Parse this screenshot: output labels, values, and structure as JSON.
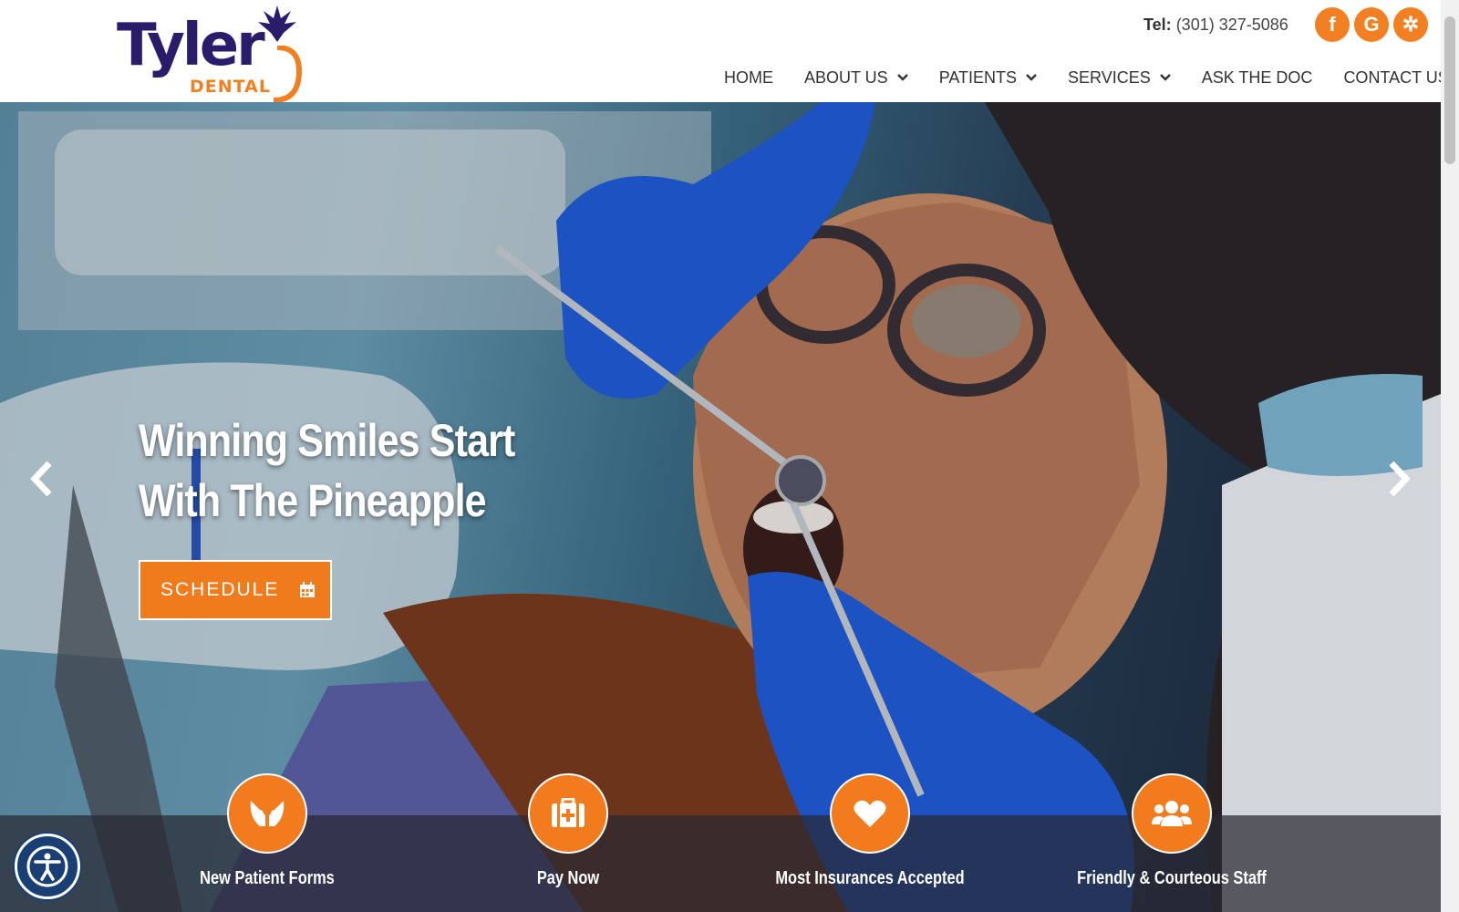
{
  "header": {
    "logo": {
      "name": "Tyler",
      "sub": "DENTAL"
    },
    "tel_label": "Tel:",
    "tel_number": "(301) 327-5086",
    "social": [
      {
        "icon": "facebook-icon",
        "glyph": "f"
      },
      {
        "icon": "google-icon",
        "glyph": "G"
      },
      {
        "icon": "yelp-icon",
        "glyph": "✲"
      }
    ],
    "nav": [
      {
        "label": "HOME",
        "dropdown": false
      },
      {
        "label": "ABOUT US",
        "dropdown": true
      },
      {
        "label": "PATIENTS",
        "dropdown": true
      },
      {
        "label": "SERVICES",
        "dropdown": true
      },
      {
        "label": "ASK THE DOC",
        "dropdown": false
      },
      {
        "label": "CONTACT US",
        "dropdown": false
      }
    ]
  },
  "hero": {
    "headline_line1": "Winning Smiles Start",
    "headline_line2": "With The Pineapple",
    "cta_label": "SCHEDULE"
  },
  "features": [
    {
      "label": "New Patient Forms",
      "icon": "hands-icon"
    },
    {
      "label": "Pay Now",
      "icon": "medical-kit-icon"
    },
    {
      "label": "Most Insurances Accepted",
      "icon": "heart-icon"
    },
    {
      "label": "Friendly & Courteous Staff",
      "icon": "users-icon"
    }
  ],
  "colors": {
    "accent": "#f28022",
    "brand_navy": "#2a1b6b",
    "accessibility_blue": "#1a3f74"
  }
}
